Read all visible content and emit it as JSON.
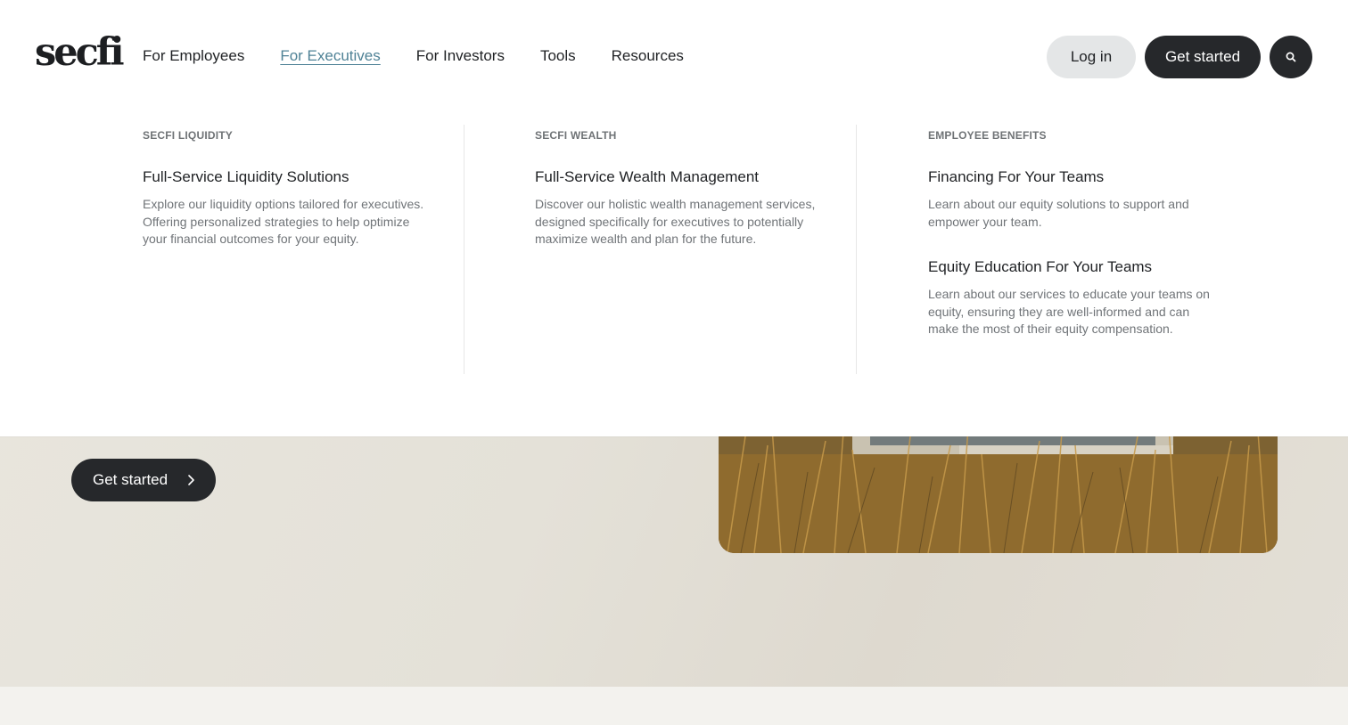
{
  "brand": {
    "logo_text": "secfi"
  },
  "nav": {
    "items": [
      {
        "label": "For Employees",
        "active": false
      },
      {
        "label": "For Executives",
        "active": true
      },
      {
        "label": "For Investors",
        "active": false
      },
      {
        "label": "Tools",
        "active": false
      },
      {
        "label": "Resources",
        "active": false
      }
    ]
  },
  "header_actions": {
    "login_label": "Log in",
    "get_started_label": "Get started",
    "search_icon": "search-icon"
  },
  "mega_menu": {
    "columns": [
      {
        "heading": "SECFI LIQUIDITY",
        "items": [
          {
            "title": "Full-Service Liquidity Solutions",
            "description": "Explore our liquidity options tailored for executives. Offering personalized strategies to help optimize your financial outcomes for your equity."
          }
        ]
      },
      {
        "heading": "SECFI WEALTH",
        "items": [
          {
            "title": "Full-Service Wealth Management",
            "description": "Discover our holistic wealth management services, designed specifically for executives to potentially maximize wealth and plan for the future."
          }
        ]
      },
      {
        "heading": "EMPLOYEE BENEFITS",
        "items": [
          {
            "title": "Financing For Your Teams",
            "description": "Learn about our equity solutions to support and empower your team."
          },
          {
            "title": "Equity Education For Your Teams",
            "description": "Learn about our services to educate your teams on equity, ensuring they are well-informed and can make the most of their equity compensation."
          }
        ]
      }
    ]
  },
  "hero": {
    "cta_label": "Get started",
    "cta_icon": "chevron-right-icon"
  },
  "colors": {
    "accent": "#4f8296",
    "dark_button": "#26282b",
    "light_button": "#e4e6e7",
    "hero_background": "#e6e3db"
  }
}
